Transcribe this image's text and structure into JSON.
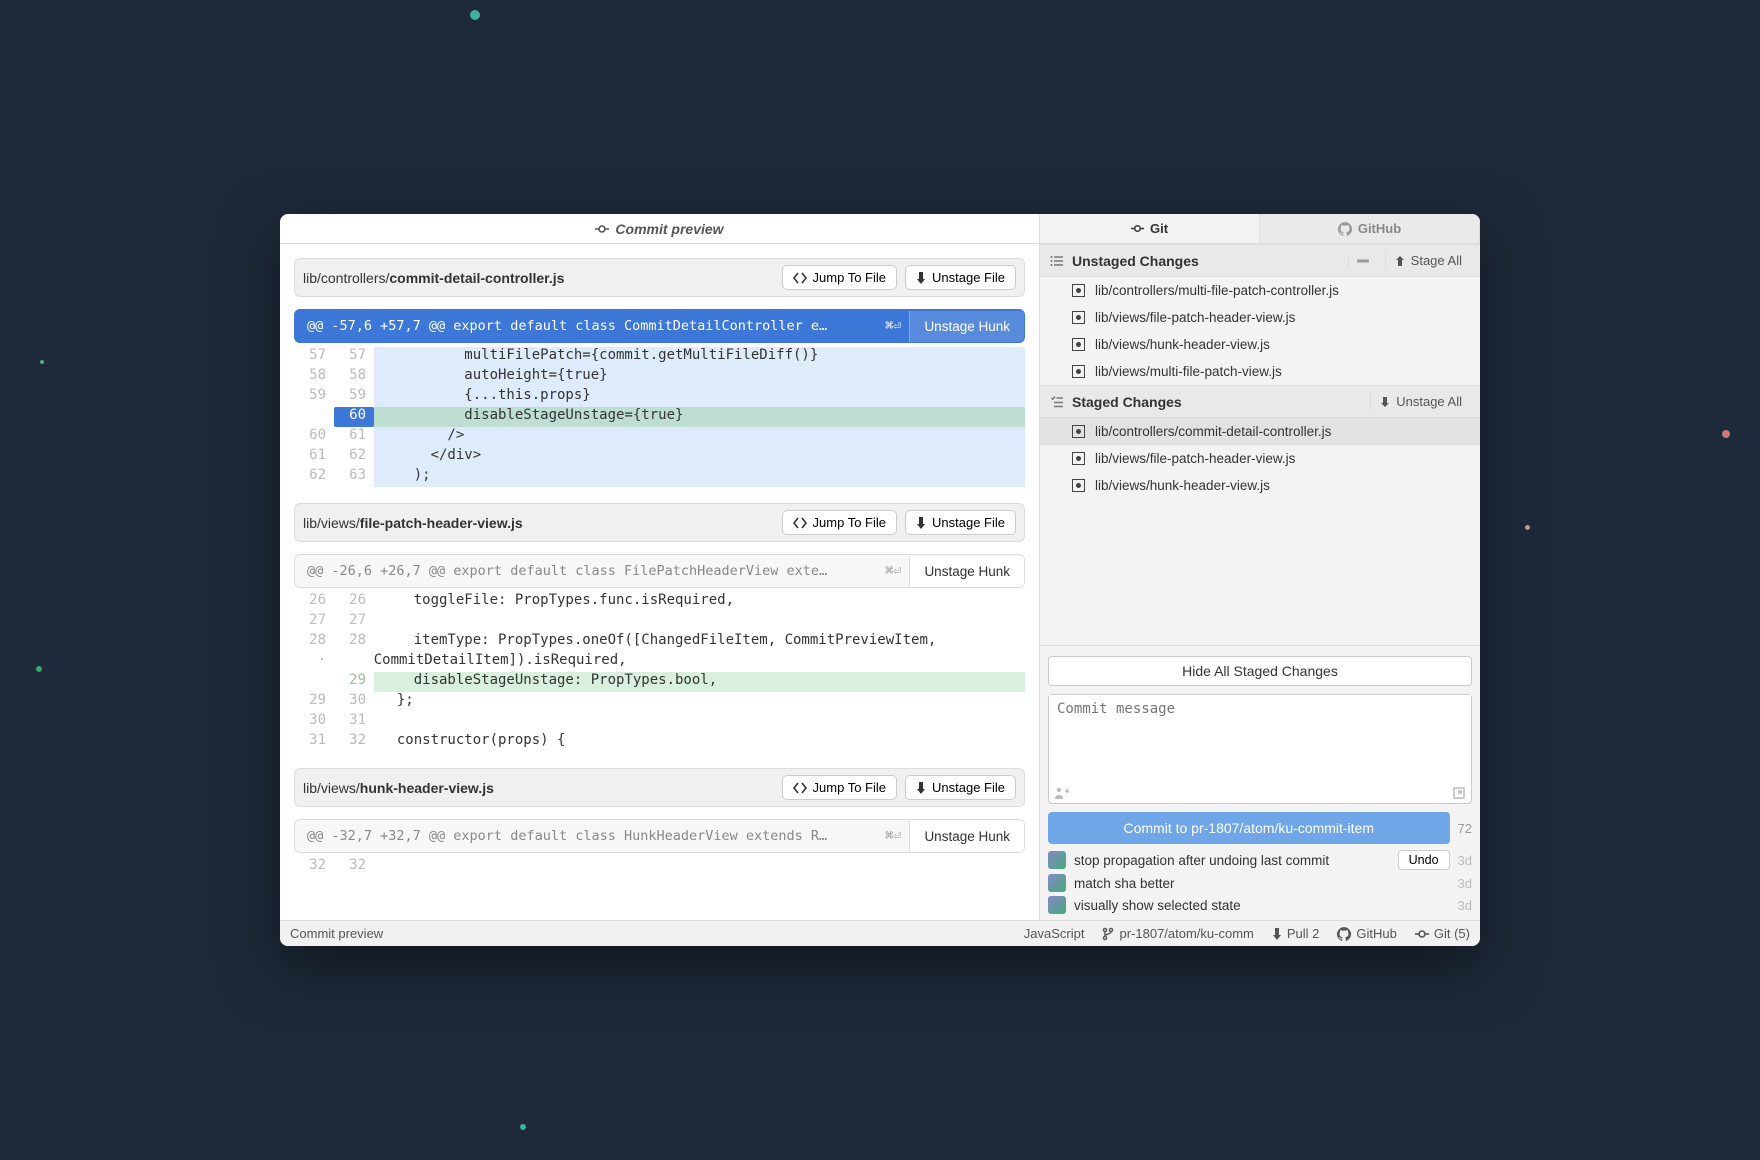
{
  "tab": {
    "title": "Commit preview"
  },
  "diff": {
    "files": [
      {
        "dir": "lib/controllers/",
        "name": "commit-detail-controller.js",
        "jump": "Jump To File",
        "unstage_file": "Unstage File",
        "selected": true,
        "hunks": [
          {
            "selected": true,
            "info": "@@ -57,6 +57,7 @@ export default class CommitDetailController e…",
            "kbd": "⌘⏎",
            "btn": "Unstage Hunk",
            "lines": [
              {
                "o": "57",
                "n": "57",
                "t": "ctx",
                "c": "          multiFilePatch={commit.getMultiFileDiff()}"
              },
              {
                "o": "58",
                "n": "58",
                "t": "ctx",
                "c": "          autoHeight={true}"
              },
              {
                "o": "59",
                "n": "59",
                "t": "ctx",
                "c": "          {...this.props}"
              },
              {
                "o": "",
                "n": "60",
                "t": "add",
                "c": "          disableStageUnstage={true}"
              },
              {
                "o": "60",
                "n": "61",
                "t": "ctx",
                "c": "        />"
              },
              {
                "o": "61",
                "n": "62",
                "t": "ctx",
                "c": "      </div>"
              },
              {
                "o": "62",
                "n": "63",
                "t": "ctx",
                "c": "    );"
              }
            ]
          }
        ]
      },
      {
        "dir": "lib/views/",
        "name": "file-patch-header-view.js",
        "jump": "Jump To File",
        "unstage_file": "Unstage File",
        "selected": false,
        "hunks": [
          {
            "selected": false,
            "info": "@@ -26,6 +26,7 @@ export default class FilePatchHeaderView exte…",
            "kbd": "⌘⏎",
            "btn": "Unstage Hunk",
            "lines": [
              {
                "o": "26",
                "n": "26",
                "t": "ctx",
                "c": "    toggleFile: PropTypes.func.isRequired,"
              },
              {
                "o": "27",
                "n": "27",
                "t": "ctx",
                "c": ""
              },
              {
                "o": "28",
                "n": "28",
                "t": "ctx",
                "c": "    itemType: PropTypes.oneOf([ChangedFileItem, CommitPreviewItem,"
              },
              {
                "o": "·",
                "n": "",
                "t": "ctx",
                "c": "    CommitDetailItem]).isRequired,"
              },
              {
                "o": "",
                "n": "29",
                "t": "plainadd",
                "c": "    disableStageUnstage: PropTypes.bool,"
              },
              {
                "o": "29",
                "n": "30",
                "t": "ctx",
                "c": "  };"
              },
              {
                "o": "30",
                "n": "31",
                "t": "ctx",
                "c": ""
              },
              {
                "o": "31",
                "n": "32",
                "t": "ctx",
                "c": "  constructor(props) {"
              }
            ]
          }
        ]
      },
      {
        "dir": "lib/views/",
        "name": "hunk-header-view.js",
        "jump": "Jump To File",
        "unstage_file": "Unstage File",
        "selected": false,
        "hunks": [
          {
            "selected": false,
            "info": "@@ -32,7 +32,7 @@ export default class HunkHeaderView extends R…",
            "kbd": "⌘⏎",
            "btn": "Unstage Hunk",
            "lines": [
              {
                "o": "32",
                "n": "32",
                "t": "ctx",
                "c": ""
              }
            ]
          }
        ]
      }
    ]
  },
  "git": {
    "tabs": {
      "git": "Git",
      "github": "GitHub"
    },
    "unstaged": {
      "title": "Unstaged Changes",
      "stage_all": "Stage All",
      "items": [
        "lib/controllers/multi-file-patch-controller.js",
        "lib/views/file-patch-header-view.js",
        "lib/views/hunk-header-view.js",
        "lib/views/multi-file-patch-view.js"
      ]
    },
    "staged": {
      "title": "Staged Changes",
      "unstage_all": "Unstage All",
      "items": [
        "lib/controllers/commit-detail-controller.js",
        "lib/views/file-patch-header-view.js",
        "lib/views/hunk-header-view.js"
      ],
      "selected": 0
    },
    "hide_all": "Hide All Staged Changes",
    "commit_msg_placeholder": "Commit message",
    "commit_btn": "Commit to pr-1807/atom/ku-commit-item",
    "col72": "72",
    "recent": [
      {
        "msg": "stop propagation after undoing last commit",
        "age": "3d",
        "undo": "Undo"
      },
      {
        "msg": "match sha better",
        "age": "3d"
      },
      {
        "msg": "visually show selected state",
        "age": "3d"
      }
    ]
  },
  "statusbar": {
    "left": "Commit preview",
    "lang": "JavaScript",
    "branch": "pr-1807/atom/ku-comm",
    "pull": "Pull 2",
    "github": "GitHub",
    "git": "Git (5)"
  }
}
